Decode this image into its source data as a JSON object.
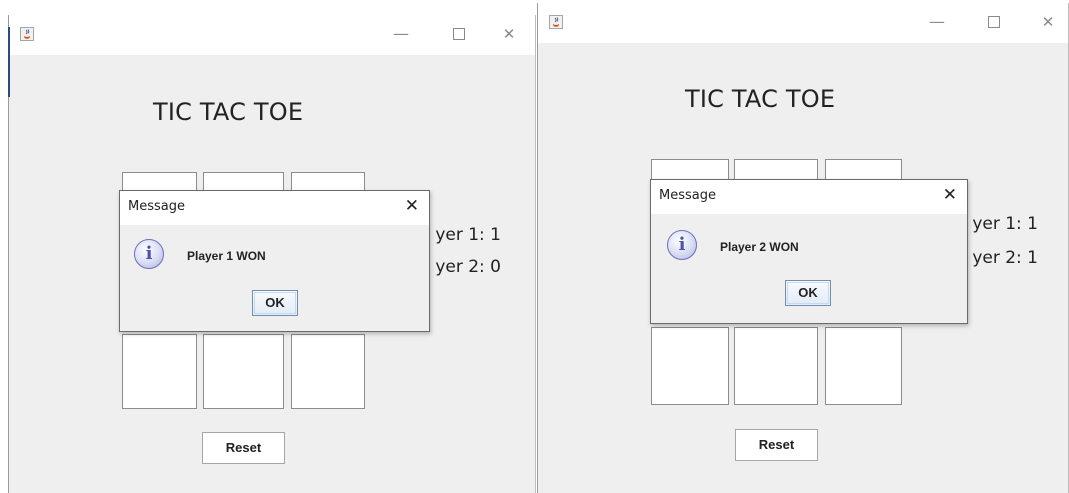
{
  "windows": [
    {
      "controls": {
        "minimize": "—",
        "maximize": "☐",
        "close": "✕"
      },
      "game_title": "TIC TAC TOE",
      "scores": {
        "player1": "yer 1: 1",
        "player2": "yer 2: 0"
      },
      "reset_label": "Reset",
      "dialog": {
        "title": "Message",
        "close": "✕",
        "message": "Player 1 WON",
        "ok_label": "OK",
        "icon": "info-icon"
      }
    },
    {
      "controls": {
        "minimize": "—",
        "maximize": "☐",
        "close": "✕"
      },
      "game_title": "TIC TAC TOE",
      "scores": {
        "player1": "yer 1: 1",
        "player2": "yer 2: 1"
      },
      "reset_label": "Reset",
      "dialog": {
        "title": "Message",
        "close": "✕",
        "message": "Player 2 WON",
        "ok_label": "OK",
        "icon": "info-icon"
      }
    }
  ],
  "colors": {
    "window_bg": "#efefef",
    "titlebar_bg": "#ffffff",
    "accent": "#2c4a86"
  }
}
